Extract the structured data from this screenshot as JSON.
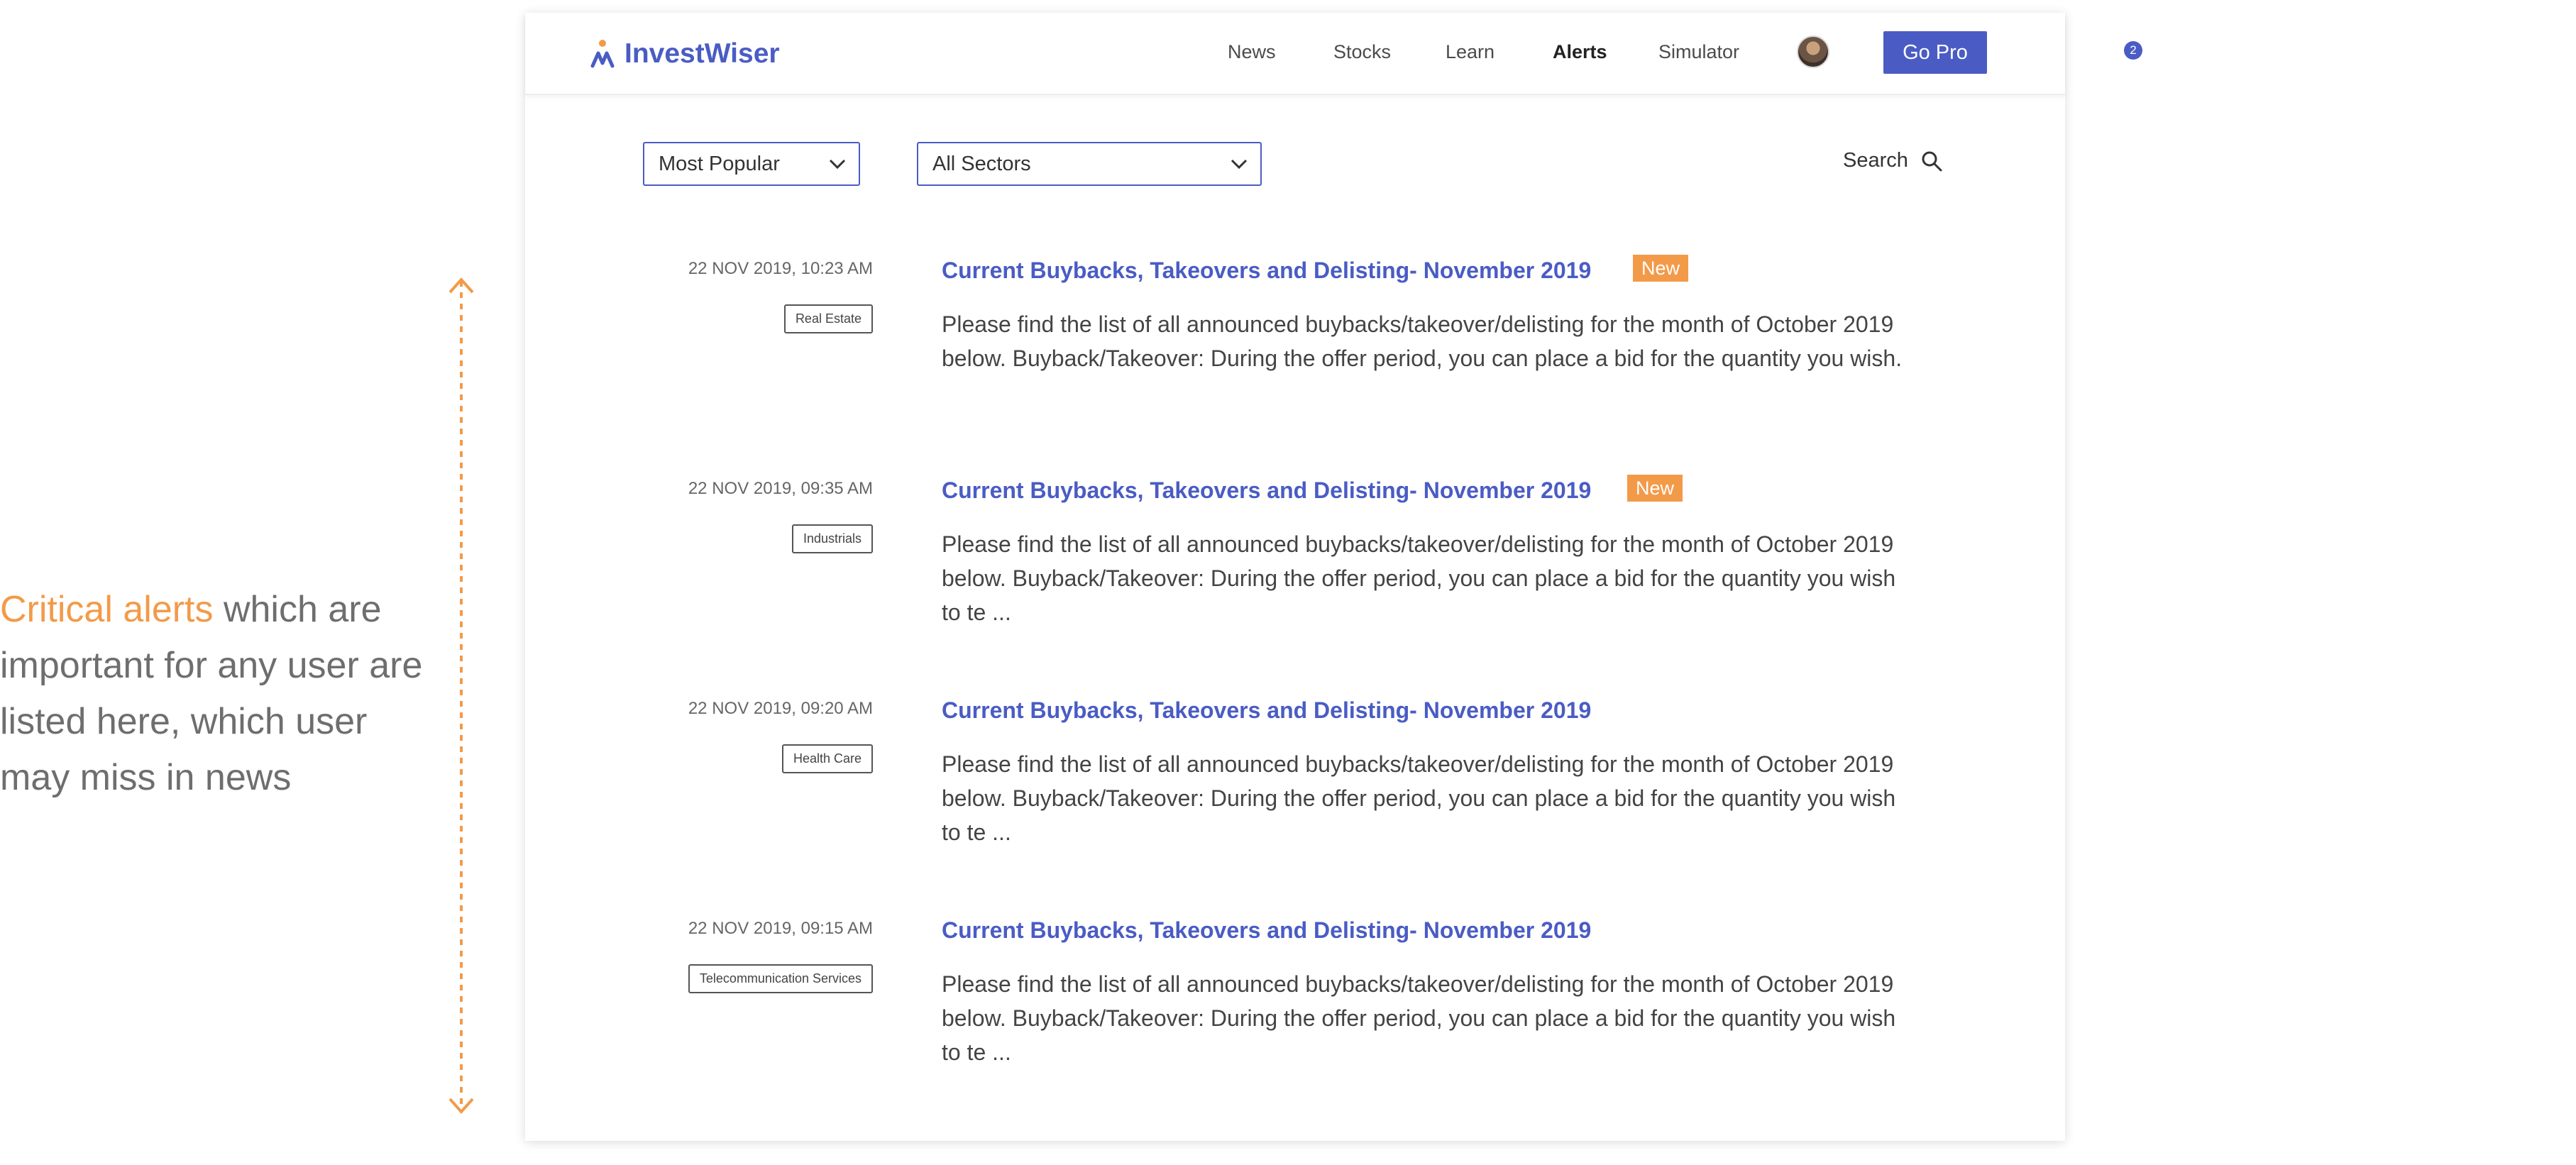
{
  "annotation": {
    "highlight": "Critical alerts",
    "text": " which are important for any user are listed here, which user may miss in news"
  },
  "app": {
    "logo_text": "InvestWiser",
    "nav": [
      {
        "label": "News"
      },
      {
        "label": "Stocks"
      },
      {
        "label": "Learn"
      },
      {
        "label": "Alerts",
        "active": true,
        "badge": "2"
      },
      {
        "label": "Simulator"
      }
    ],
    "go_pro_label": "Go Pro",
    "filters": {
      "sort": {
        "selected": "Most Popular"
      },
      "sector": {
        "selected": "All Sectors"
      },
      "search_label": "Search"
    },
    "alerts": [
      {
        "date": "22 NOV 2019, 10:23 AM",
        "tag": "Real Estate",
        "title": "Current Buybacks, Takeovers and Delisting- November 2019",
        "new_label": "New",
        "body": "Please find the list of all announced buybacks/takeover/delisting for the month of October 2019 below. Buyback/Takeover: During the offer period, you can place a bid for the quantity you wish."
      },
      {
        "date": "22 NOV 2019, 09:35 AM",
        "tag": "Industrials",
        "title": "Current Buybacks, Takeovers and Delisting- November 2019",
        "new_label": "New",
        "body": "Please find the list of all announced buybacks/takeover/delisting for the month of October 2019 below. Buyback/Takeover: During the offer period, you can place a bid for the quantity you wish to te ..."
      },
      {
        "date": "22 NOV 2019, 09:20 AM",
        "tag": "Health Care",
        "title": "Current Buybacks, Takeovers and Delisting- November 2019",
        "new_label": "",
        "body": "Please find the list of all announced buybacks/takeover/delisting for the month of October 2019 below. Buyback/Takeover: During the offer period, you can place a bid for the quantity you wish to te ..."
      },
      {
        "date": "22 NOV 2019, 09:15 AM",
        "tag": "Telecommunication Services",
        "title": "Current Buybacks, Takeovers and Delisting- November 2019",
        "new_label": "",
        "body": "Please find the list of all announced buybacks/takeover/delisting for the month of October 2019 below. Buyback/Takeover: During the offer period, you can place a bid for the quantity you wish to te ..."
      }
    ]
  },
  "colors": {
    "brand": "#4a5cc4",
    "accent": "#f39a49",
    "text": "#444444"
  },
  "icons": {
    "logo": "investwiser-logo-icon",
    "search": "search-icon",
    "dropdown": "chevron-down-icon",
    "annotation_arrow": "double-arrow-vertical-icon"
  }
}
